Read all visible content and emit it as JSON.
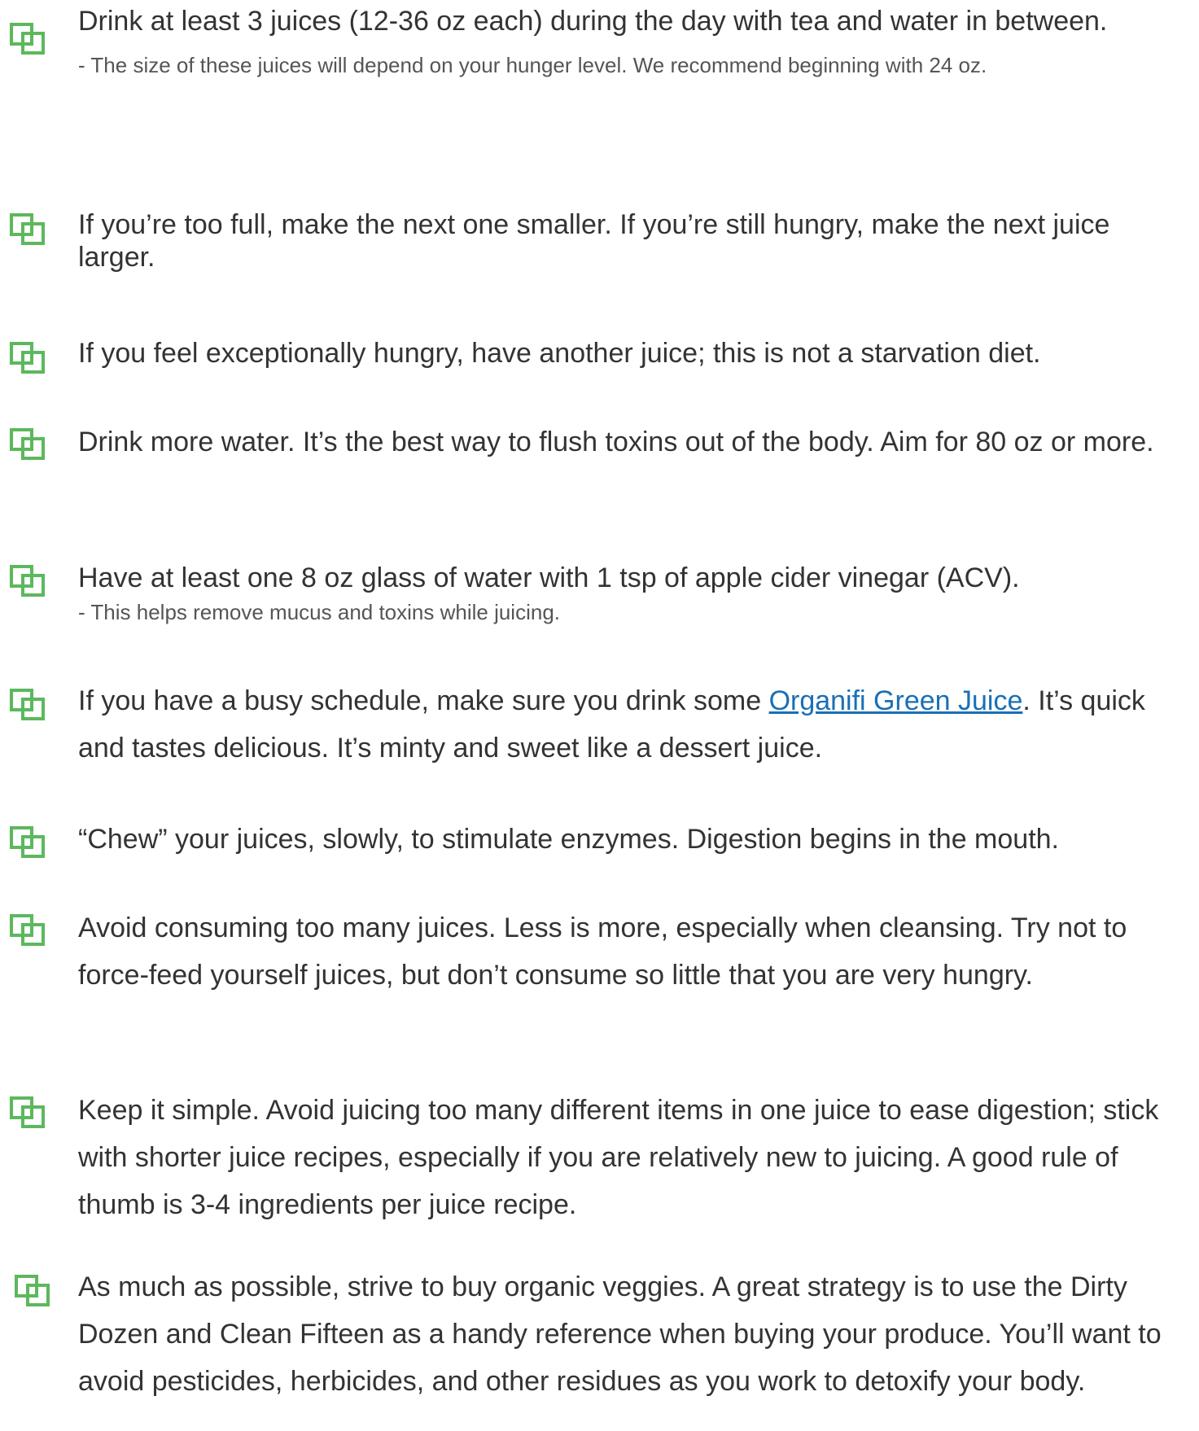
{
  "colors": {
    "bullet_icon": "#5cb85c",
    "text": "#333333",
    "note_text": "#555555",
    "link": "#1a6fb5"
  },
  "bullet_icon_name": "checkbox-icon",
  "items": [
    {
      "text": "Drink at least 3 juices (12-36 oz each) during the day with tea and water in between.",
      "note": "- The size of these juices will depend on your hunger level. We recommend beginning with 24 oz."
    },
    {
      "text": "If you’re too full, make the next one smaller. If you’re still hungry, make the next juice larger."
    },
    {
      "text": "If you feel exceptionally hungry, have another juice; this is not a starvation diet."
    },
    {
      "text": "Drink more water. It’s the best way to flush toxins out of the body. Aim for 80 oz or more."
    },
    {
      "text": "Have at least one 8 oz glass of water with 1 tsp of apple cider vinegar (ACV).",
      "note": "- This helps remove mucus and toxins while juicing."
    },
    {
      "text_before": "If you have a busy schedule, make sure you drink some ",
      "link": "Organifi Green Juice",
      "text_after": ".  It’s quick and tastes delicious.  It’s minty and sweet like a dessert juice."
    },
    {
      "text": "“Chew” your juices, slowly, to stimulate enzymes. Digestion begins in the mouth."
    },
    {
      "text": "Avoid consuming too many juices. Less is more, especially when cleansing. Try not to force-feed yourself juices, but don’t consume so little that you are very hungry."
    },
    {
      "text": "Keep it simple. Avoid juicing too many different items in one juice to ease digestion; stick with shorter juice recipes, especially if you are relatively new to juicing. A good rule of thumb is 3-4 ingredients per juice recipe."
    },
    {
      "text": "As much as possible, strive to buy organic veggies. A great strategy is to use the Dirty Dozen and Clean Fifteen as a handy reference when buying your produce. You’ll want to avoid pesticides, herbicides, and other residues as you work to detoxify your body."
    }
  ]
}
